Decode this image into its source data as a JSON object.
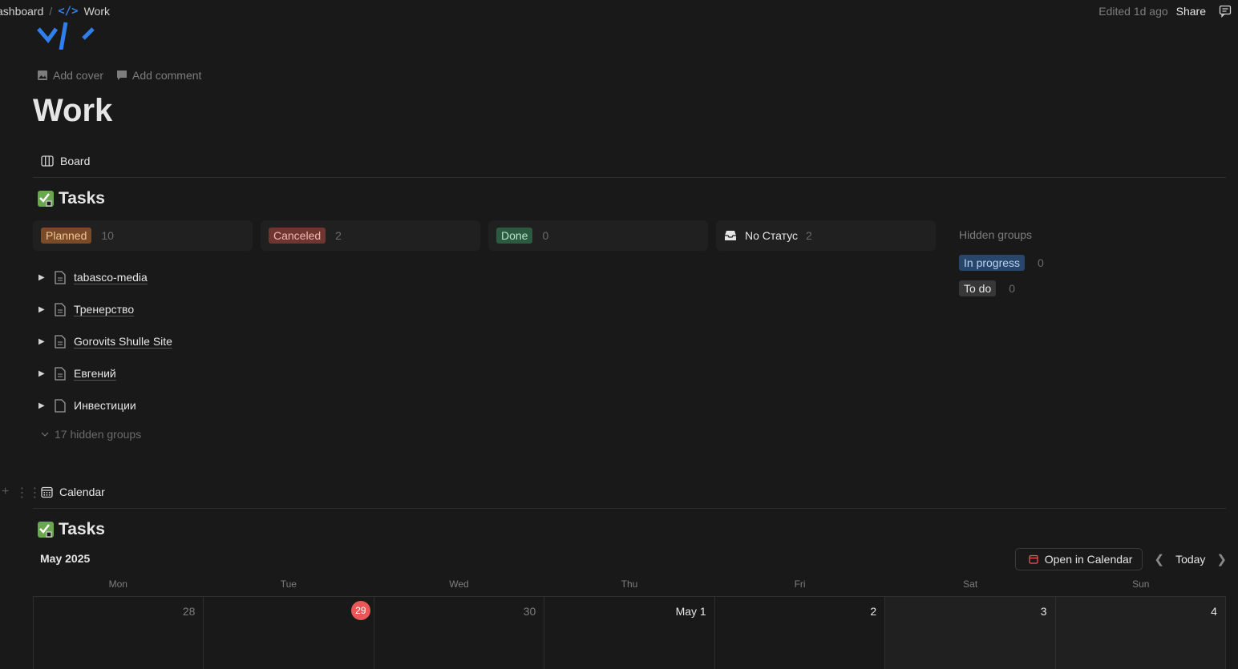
{
  "breadcrumb": {
    "parent": "ashboard",
    "separator": "/",
    "current": "Work"
  },
  "topbar": {
    "edited": "Edited 1d ago",
    "share": "Share"
  },
  "page": {
    "add_cover": "Add cover",
    "add_comment": "Add comment",
    "title": "Work"
  },
  "board_view": {
    "tab_label": "Board",
    "db_title": "Tasks",
    "groups": [
      {
        "label": "Planned",
        "count": "10",
        "color": "#7a4b26",
        "text": "#f0c69a"
      },
      {
        "label": "Canceled",
        "count": "2",
        "color": "#6e3630",
        "text": "#f0b8b0"
      },
      {
        "label": "Done",
        "count": "0",
        "color": "#2b5a40",
        "text": "#b8e6c8"
      },
      {
        "label": "No Статус",
        "count": "2"
      }
    ],
    "hidden_col": {
      "title": "Hidden groups",
      "items": [
        {
          "label": "In progress",
          "count": "0",
          "color": "#28456c"
        },
        {
          "label": "To do",
          "count": "0",
          "color": "#373737"
        }
      ]
    },
    "rows": [
      "tabasco-media",
      "Тренерство",
      "Gorovits Shulle Site",
      "Евгений",
      "Инвестиции"
    ],
    "hidden_groups": "17 hidden groups"
  },
  "calendar_view": {
    "tab_label": "Calendar",
    "db_title": "Tasks",
    "month": "May 2025",
    "open_in_calendar": "Open in Calendar",
    "today": "Today",
    "weekdays": [
      "Mon",
      "Tue",
      "Wed",
      "Thu",
      "Fri",
      "Sat",
      "Sun"
    ],
    "days": [
      "28",
      "29",
      "30",
      "May 1",
      "2",
      "3",
      "4"
    ]
  }
}
